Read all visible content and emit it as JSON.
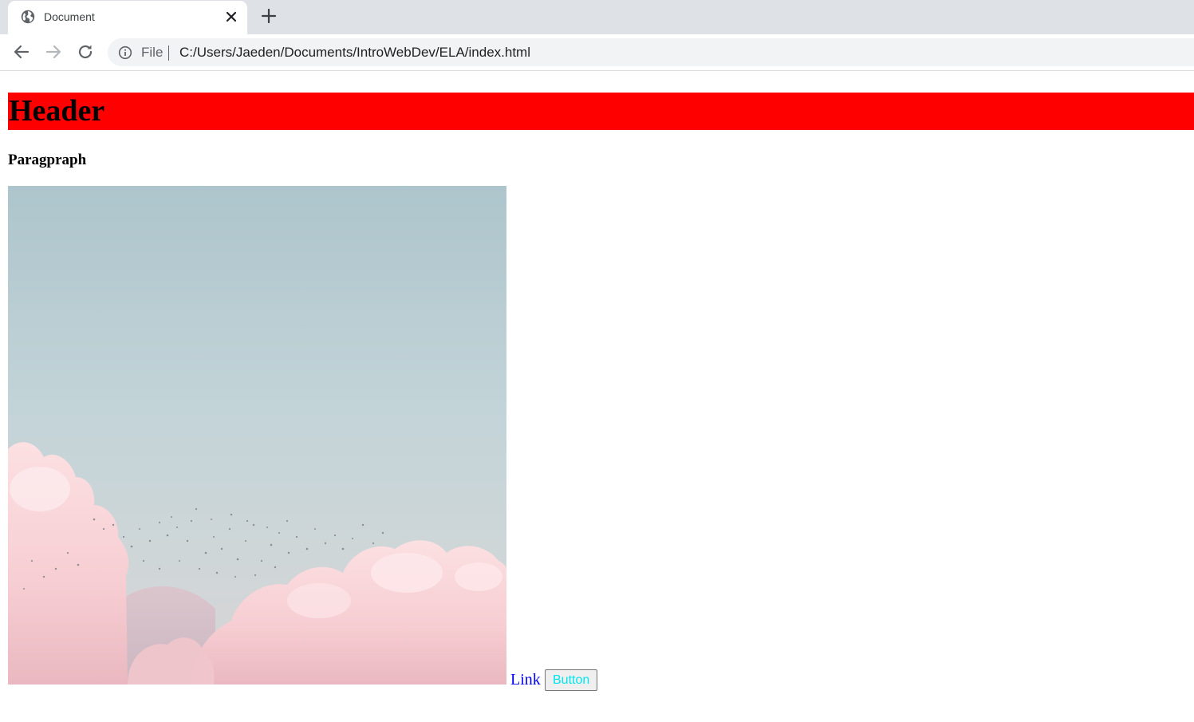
{
  "browser": {
    "tab": {
      "title": "Document",
      "favicon": "globe-icon"
    },
    "toolbar": {
      "back_icon": "arrow-left-icon",
      "forward_icon": "arrow-right-icon",
      "reload_icon": "reload-icon",
      "site_info_icon": "info-icon",
      "scheme_label": "File",
      "url": "C:/Users/Jaeden/Documents/IntroWebDev/ELA/index.html"
    }
  },
  "page": {
    "header": {
      "text": "Header",
      "background_color": "#ff0000"
    },
    "paragraph": "Paragpraph",
    "image": {
      "subject": "pink clouds with flock of birds against pale blue sky"
    },
    "link": {
      "text": "Link",
      "color": "#0000ee"
    },
    "button": {
      "text": "Button",
      "text_color": "#00e5ee"
    }
  }
}
